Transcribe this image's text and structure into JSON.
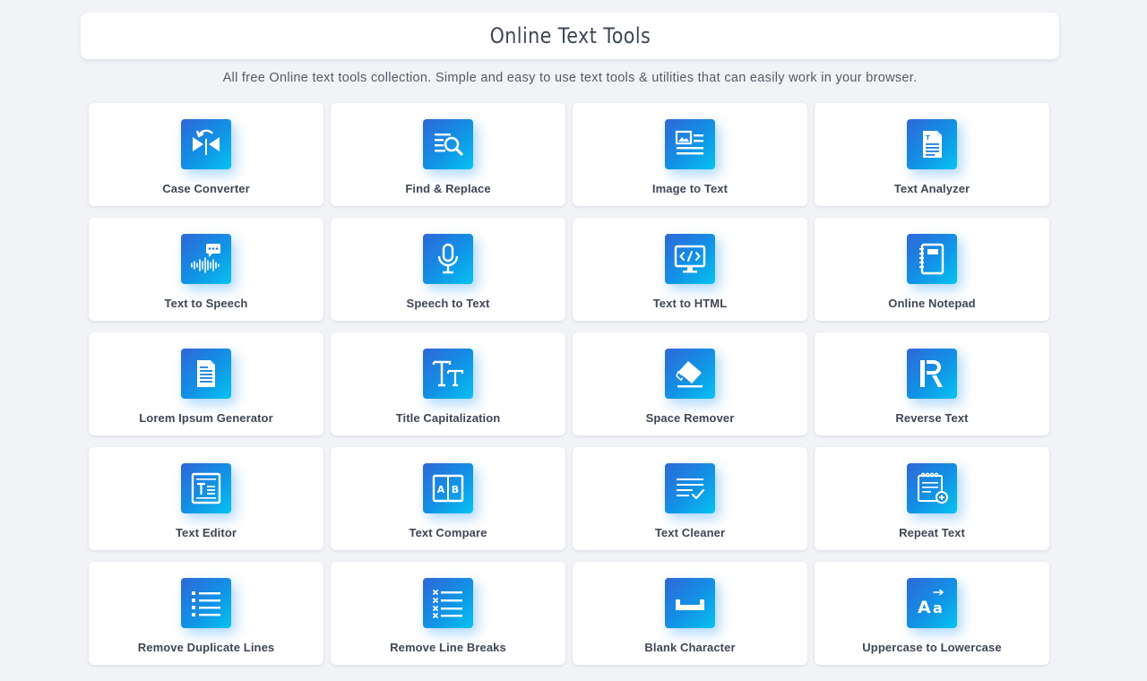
{
  "header": {
    "title": "Online Text Tools",
    "subtitle": "All free Online text tools collection. Simple and easy to use text tools & utilities that can easily work in your browser."
  },
  "colors": {
    "background": "#f1f3f7",
    "card": "#ffffff",
    "icon_gradient_start": "#2f67d8",
    "icon_gradient_end": "#06c3f0",
    "text": "#3f4656"
  },
  "tools": [
    {
      "label": "Case Converter",
      "icon": "case-converter-icon"
    },
    {
      "label": "Find & Replace",
      "icon": "find-replace-icon"
    },
    {
      "label": "Image to Text",
      "icon": "image-to-text-icon"
    },
    {
      "label": "Text Analyzer",
      "icon": "text-analyzer-icon"
    },
    {
      "label": "Text to Speech",
      "icon": "text-to-speech-icon"
    },
    {
      "label": "Speech to Text",
      "icon": "microphone-icon"
    },
    {
      "label": "Text to HTML",
      "icon": "code-monitor-icon"
    },
    {
      "label": "Online Notepad",
      "icon": "notepad-icon"
    },
    {
      "label": "Lorem Ipsum Generator",
      "icon": "document-icon"
    },
    {
      "label": "Title Capitalization",
      "icon": "title-case-icon"
    },
    {
      "label": "Space Remover",
      "icon": "eraser-icon"
    },
    {
      "label": "Reverse Text",
      "icon": "reverse-r-icon"
    },
    {
      "label": "Text Editor",
      "icon": "text-editor-icon"
    },
    {
      "label": "Text Compare",
      "icon": "compare-ab-icon"
    },
    {
      "label": "Text Cleaner",
      "icon": "lines-check-icon"
    },
    {
      "label": "Repeat Text",
      "icon": "repeat-notebook-icon"
    },
    {
      "label": "Remove Duplicate Lines",
      "icon": "bullet-list-icon"
    },
    {
      "label": "Remove Line Breaks",
      "icon": "x-list-icon"
    },
    {
      "label": "Blank Character",
      "icon": "blank-space-icon"
    },
    {
      "label": "Uppercase to Lowercase",
      "icon": "uppercase-lowercase-icon"
    }
  ]
}
